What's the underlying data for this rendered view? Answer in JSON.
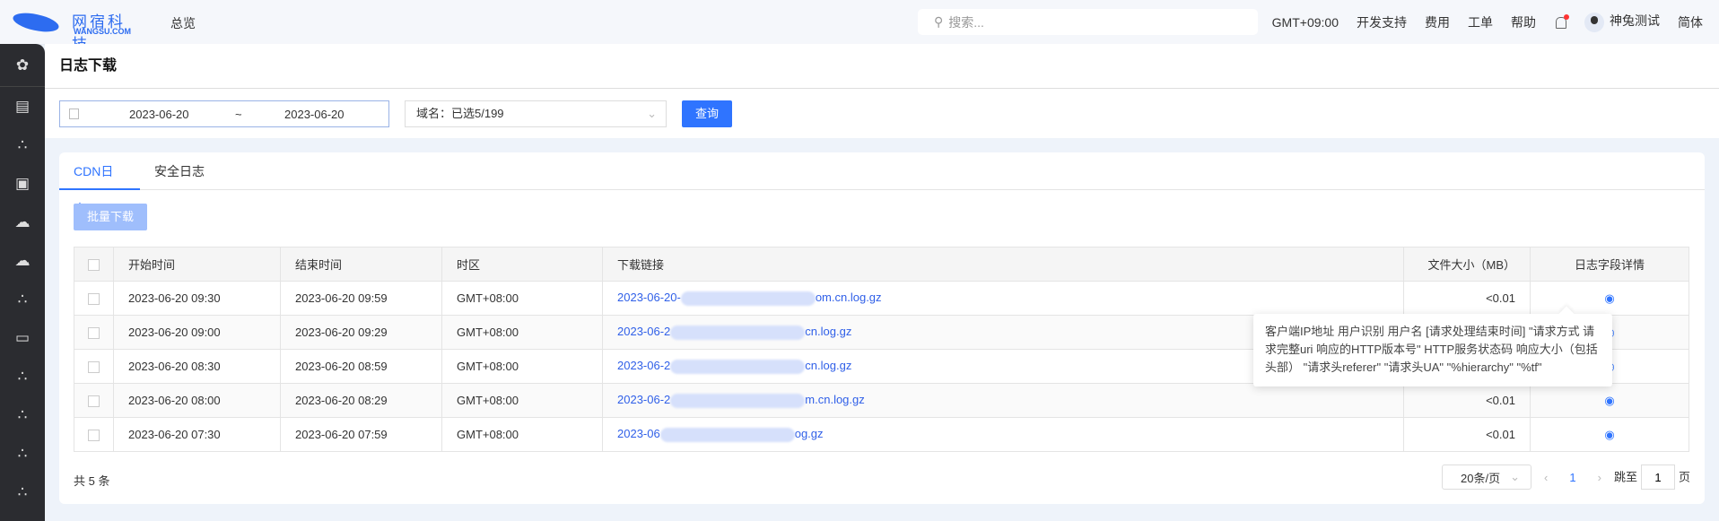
{
  "header": {
    "logo_cn": "网宿科技",
    "logo_en": "WANGSU.COM",
    "nav": "总览",
    "search_placeholder": "搜索...",
    "timezone": "GMT+09:00",
    "links": [
      "开发支持",
      "费用",
      "工单",
      "帮助"
    ],
    "user": "神兔测试",
    "language": "简体"
  },
  "sidebar": {
    "icons": [
      "apps-icon",
      "log-list-icon",
      "cluster-icon",
      "w-icon",
      "cloud-lock-icon",
      "cloud-key-icon",
      "cluster-icon",
      "monitor-icon",
      "cluster-icon",
      "cluster-icon",
      "cluster-icon",
      "cluster-icon"
    ]
  },
  "page": {
    "title": "日志下载"
  },
  "filter": {
    "date_start": "2023-06-20",
    "date_sep": "~",
    "date_end": "2023-06-20",
    "domain": "域名：已选5/199",
    "query": "查询"
  },
  "tabs": [
    "CDN日志",
    "安全日志"
  ],
  "batch_download": "批量下载",
  "table": {
    "headers": [
      "开始时间",
      "结束时间",
      "时区",
      "下载链接",
      "文件大小（MB）",
      "日志字段详情"
    ],
    "rows": [
      {
        "start": "2023-06-20 09:30",
        "end": "2023-06-20 09:59",
        "tz": "GMT+08:00",
        "link_prefix": "2023-06-20-",
        "link_suffix": "om.cn.log.gz",
        "size": "<0.01"
      },
      {
        "start": "2023-06-20 09:00",
        "end": "2023-06-20 09:29",
        "tz": "GMT+08:00",
        "link_prefix": "2023-06-2",
        "link_suffix": "cn.log.gz",
        "size": "<0.01"
      },
      {
        "start": "2023-06-20 08:30",
        "end": "2023-06-20 08:59",
        "tz": "GMT+08:00",
        "link_prefix": "2023-06-2",
        "link_suffix": "cn.log.gz",
        "size": "<0.01"
      },
      {
        "start": "2023-06-20 08:00",
        "end": "2023-06-20 08:29",
        "tz": "GMT+08:00",
        "link_prefix": "2023-06-2",
        "link_suffix": "m.cn.log.gz",
        "size": "<0.01"
      },
      {
        "start": "2023-06-20 07:30",
        "end": "2023-06-20 07:59",
        "tz": "GMT+08:00",
        "link_prefix": "2023-06",
        "link_suffix": "og.gz",
        "size": "<0.01"
      }
    ]
  },
  "tooltip": "客户端IP地址 用户识别 用户名 [请求处理结束时间] \"请求方式 请求完整uri 响应的HTTP版本号\" HTTP服务状态码 响应大小（包括头部） \"请求头referer\" \"请求头UA\" \"%hierarchy\" \"%tf\"",
  "footer": {
    "total": "共 5 条",
    "page_size": "20条/页",
    "current_page": "1",
    "jump_label": "跳至",
    "jump_value": "1",
    "page_unit": "页"
  },
  "colors": {
    "primary": "#2f74ff",
    "sidebar": "#2b2c30"
  }
}
